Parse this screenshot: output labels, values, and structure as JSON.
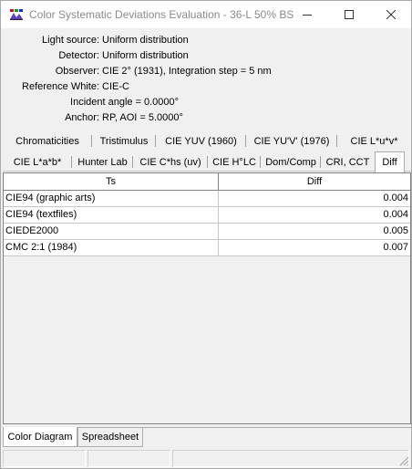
{
  "window": {
    "title": "Color Systematic Deviations Evaluation - 36-L 50% BS",
    "icon": "color-app-icon"
  },
  "info": {
    "light_source_label": "Light source:",
    "light_source_value": "Uniform distribution",
    "detector_label": "Detector:",
    "detector_value": "Uniform distribution",
    "observer_label": "Observer:",
    "observer_value": "CIE 2° (1931),   Integration step = 5 nm",
    "reference_white_label": "Reference White:",
    "reference_white_value": "CIE-C",
    "incident_angle_label": "Incident angle =",
    "incident_angle_value": "0.0000°",
    "anchor_label": "Anchor:",
    "anchor_value": "RP,   AOI =  5.0000°"
  },
  "tabs_row1": [
    "Chromaticities",
    "Tristimulus",
    "CIE YUV (1960)",
    "CIE YU'V' (1976)",
    "CIE L*u*v*"
  ],
  "tabs_row2": [
    "CIE L*a*b*",
    "Hunter Lab",
    "CIE C*hs (uv)",
    "CIE H°LC",
    "Dom/Comp",
    "CRI, CCT",
    "Diff"
  ],
  "active_tab": "Diff",
  "table": {
    "columns": [
      "Ts",
      "Diff"
    ],
    "rows": [
      {
        "name": "CIE94 (graphic arts)",
        "value": "0.004"
      },
      {
        "name": "CIE94 (textfiles)",
        "value": "0.004"
      },
      {
        "name": "CIEDE2000",
        "value": "0.005"
      },
      {
        "name": "CMC 2:1 (1984)",
        "value": "0.007"
      }
    ]
  },
  "bottom_tabs": [
    "Color Diagram",
    "Spreadsheet"
  ],
  "active_bottom_tab": "Color Diagram"
}
